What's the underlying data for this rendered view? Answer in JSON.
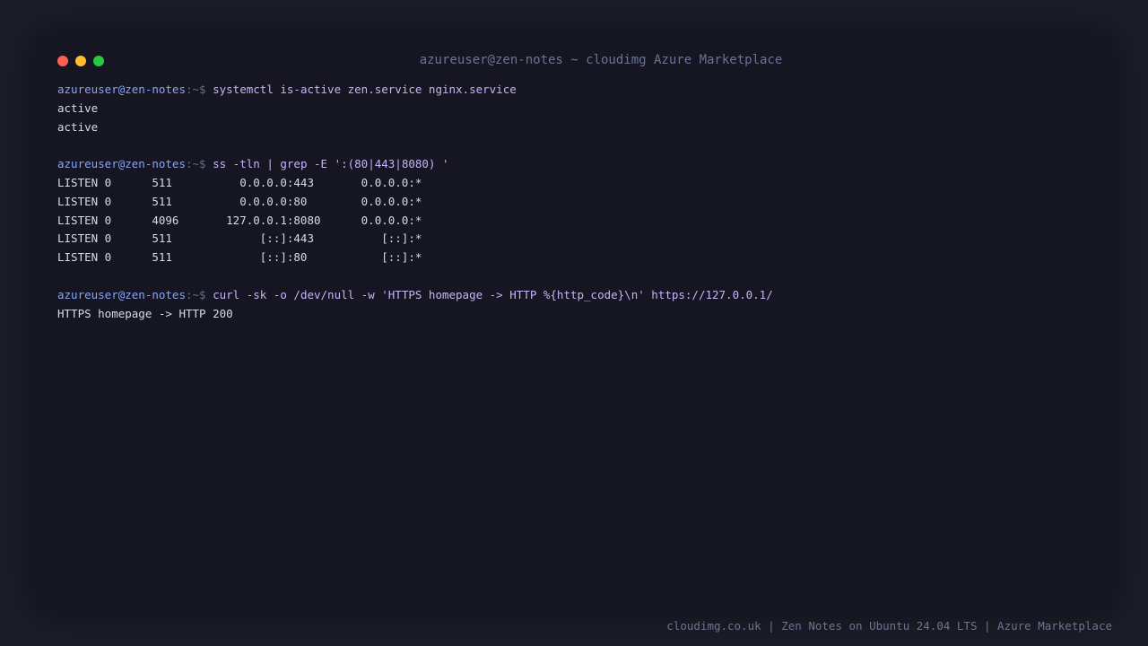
{
  "window": {
    "title": "azureuser@zen-notes ~ cloudimg Azure Marketplace"
  },
  "prompt": {
    "user_host": "azureuser@zen-notes",
    "suffix": ":~$"
  },
  "session": {
    "cmd1": "systemctl is-active zen.service nginx.service",
    "out1": [
      "active",
      "active"
    ],
    "cmd2": "ss -tln | grep -E ':(80|443|8080) '",
    "out2": [
      "LISTEN 0      511          0.0.0.0:443       0.0.0.0:*",
      "LISTEN 0      511          0.0.0.0:80        0.0.0.0:*",
      "LISTEN 0      4096       127.0.0.1:8080      0.0.0.0:*",
      "LISTEN 0      511             [::]:443          [::]:*",
      "LISTEN 0      511             [::]:80           [::]:*"
    ],
    "cmd3": "curl -sk -o /dev/null -w 'HTTPS homepage -> HTTP %{http_code}\\n' https://127.0.0.1/",
    "out3": [
      "HTTPS homepage -> HTTP 200"
    ]
  },
  "footer": {
    "text": "cloudimg.co.uk | Zen Notes on Ubuntu 24.04 LTS | Azure Marketplace"
  },
  "colors": {
    "background": "#1b1c27",
    "window": "#151621",
    "prompt_user": "#8aa4f5",
    "command": "#c6b4f5",
    "output": "#d8dae6",
    "close": "#ff5f57",
    "minimize": "#febc2e",
    "maximize": "#28c840"
  }
}
